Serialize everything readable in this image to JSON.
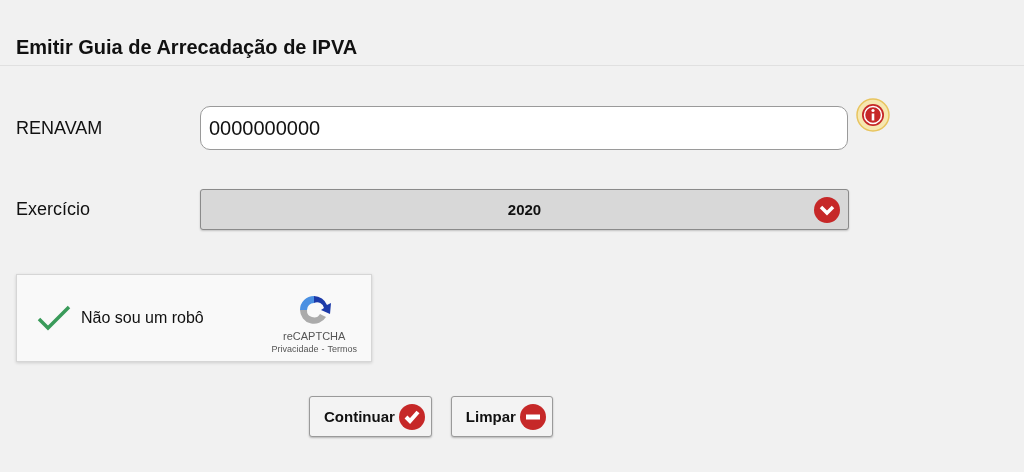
{
  "title": "Emitir Guia de Arrecadação de IPVA",
  "fields": [
    {
      "label": "RENAVAM",
      "kind": "text",
      "value": "0000000000"
    },
    {
      "label": "Exercício",
      "kind": "select",
      "value": "2020"
    }
  ],
  "captcha": {
    "label": "Não sou um robô",
    "checked": true,
    "brand": "reCAPTCHA",
    "privacy": "Privacidade",
    "separator": "-",
    "terms": "Termos"
  },
  "buttons": [
    {
      "label": "Continuar",
      "kind": "confirm"
    },
    {
      "label": "Limpar",
      "kind": "clear"
    }
  ]
}
